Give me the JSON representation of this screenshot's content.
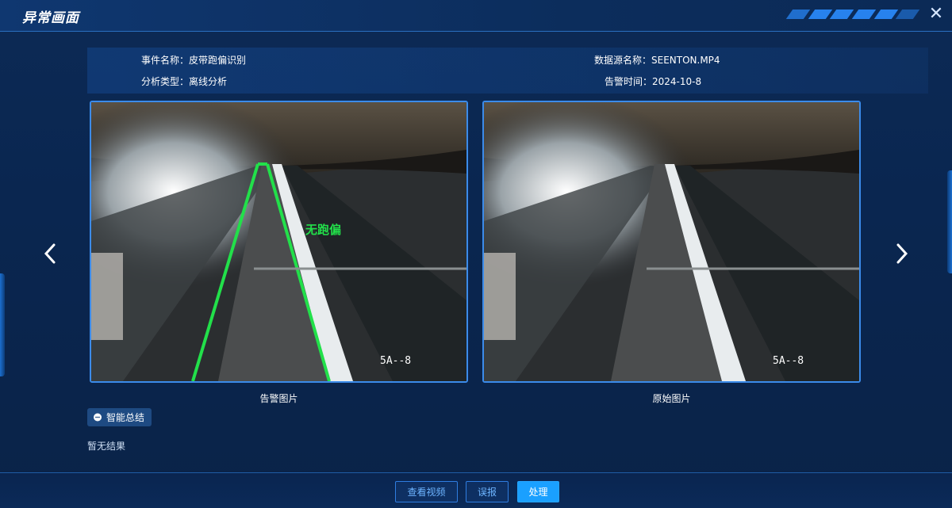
{
  "dialog": {
    "title": "异常画面",
    "close_icon": "close-icon"
  },
  "info": {
    "event_name": "事件名称：皮带跑偏识别",
    "analysis_type": "分析类型：离线分析",
    "source_name": "数据源名称：SEENTON.MP4",
    "alarm_time": "告警时间：2024-10-8"
  },
  "images": {
    "alarm": {
      "caption": "告警图片",
      "overlay_label": "无跑偏",
      "camera_id": "5A--8"
    },
    "original": {
      "caption": "原始图片",
      "camera_id": "5A--8"
    }
  },
  "summary": {
    "button_label": "智能总结",
    "result_text": "暂无结果"
  },
  "footer": {
    "view_video": "查看视频",
    "false_report": "误报",
    "handle": "处理"
  },
  "colors": {
    "accent": "#1aa0ff",
    "detect_line": "#22e04a",
    "frame_border": "#3b8bea"
  }
}
